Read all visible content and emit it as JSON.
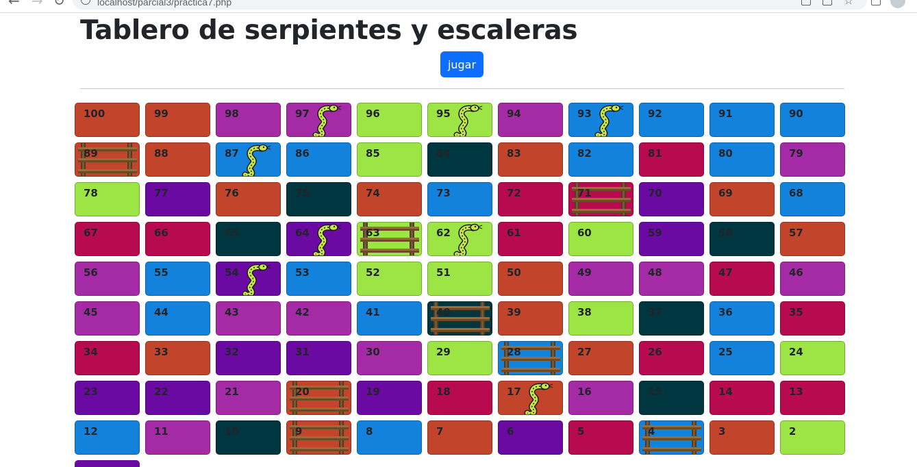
{
  "browser": {
    "url": "localhost/parcial3/practica7.php"
  },
  "page": {
    "title": "Tablero de serpientes y escaleras",
    "play_button": "jugar"
  },
  "colors": {
    "orange": "#c2452b",
    "purple": "#a52aa5",
    "green": "#9de445",
    "blue": "#1382dd",
    "darkteal": "#003640",
    "crimson": "#b80a4f",
    "violet": "#6b0aa3",
    "button": "#0d6efd"
  },
  "board": {
    "rows": [
      [
        {
          "n": "100",
          "c": "orange"
        },
        {
          "n": "99",
          "c": "orange"
        },
        {
          "n": "98",
          "c": "purple"
        },
        {
          "n": "97",
          "c": "purple",
          "img": "snake"
        },
        {
          "n": "96",
          "c": "green"
        },
        {
          "n": "95",
          "c": "green",
          "img": "snake"
        },
        {
          "n": "94",
          "c": "purple"
        },
        {
          "n": "93",
          "c": "blue",
          "img": "snake"
        },
        {
          "n": "92",
          "c": "blue"
        },
        {
          "n": "91",
          "c": "blue"
        },
        {
          "n": "90",
          "c": "blue"
        }
      ],
      [
        {
          "n": "89",
          "c": "orange",
          "img": "ladder"
        },
        {
          "n": "88",
          "c": "orange"
        },
        {
          "n": "87",
          "c": "blue",
          "img": "snake"
        },
        {
          "n": "86",
          "c": "blue"
        },
        {
          "n": "85",
          "c": "green"
        },
        {
          "n": "84",
          "c": "darkteal"
        },
        {
          "n": "83",
          "c": "orange"
        },
        {
          "n": "82",
          "c": "blue"
        },
        {
          "n": "81",
          "c": "crimson"
        },
        {
          "n": "80",
          "c": "blue"
        },
        {
          "n": "79",
          "c": "purple"
        }
      ],
      [
        {
          "n": "78",
          "c": "green"
        },
        {
          "n": "77",
          "c": "violet"
        },
        {
          "n": "76",
          "c": "orange"
        },
        {
          "n": "75",
          "c": "darkteal"
        },
        {
          "n": "74",
          "c": "orange"
        },
        {
          "n": "73",
          "c": "blue"
        },
        {
          "n": "72",
          "c": "crimson"
        },
        {
          "n": "71",
          "c": "crimson",
          "img": "ladder"
        },
        {
          "n": "70",
          "c": "violet"
        },
        {
          "n": "69",
          "c": "orange"
        },
        {
          "n": "68",
          "c": "blue"
        }
      ],
      [
        {
          "n": "67",
          "c": "crimson"
        },
        {
          "n": "66",
          "c": "crimson"
        },
        {
          "n": "65",
          "c": "darkteal"
        },
        {
          "n": "64",
          "c": "violet",
          "img": "snake"
        },
        {
          "n": "63",
          "c": "green",
          "img": "ladder"
        },
        {
          "n": "62",
          "c": "green",
          "img": "snake"
        },
        {
          "n": "61",
          "c": "crimson"
        },
        {
          "n": "60",
          "c": "green"
        },
        {
          "n": "59",
          "c": "violet"
        },
        {
          "n": "58",
          "c": "darkteal"
        },
        {
          "n": "57",
          "c": "orange"
        }
      ],
      [
        {
          "n": "56",
          "c": "purple"
        },
        {
          "n": "55",
          "c": "blue"
        },
        {
          "n": "54",
          "c": "violet",
          "img": "snake"
        },
        {
          "n": "53",
          "c": "blue"
        },
        {
          "n": "52",
          "c": "green"
        },
        {
          "n": "51",
          "c": "green"
        },
        {
          "n": "50",
          "c": "orange"
        },
        {
          "n": "49",
          "c": "purple"
        },
        {
          "n": "48",
          "c": "purple"
        },
        {
          "n": "47",
          "c": "crimson"
        },
        {
          "n": "46",
          "c": "purple"
        }
      ],
      [
        {
          "n": "45",
          "c": "purple"
        },
        {
          "n": "44",
          "c": "blue"
        },
        {
          "n": "43",
          "c": "purple"
        },
        {
          "n": "42",
          "c": "purple"
        },
        {
          "n": "41",
          "c": "blue"
        },
        {
          "n": "40",
          "c": "darkteal",
          "img": "ladder"
        },
        {
          "n": "39",
          "c": "orange"
        },
        {
          "n": "38",
          "c": "green"
        },
        {
          "n": "37",
          "c": "darkteal"
        },
        {
          "n": "36",
          "c": "blue"
        },
        {
          "n": "35",
          "c": "crimson"
        }
      ],
      [
        {
          "n": "34",
          "c": "crimson"
        },
        {
          "n": "33",
          "c": "orange"
        },
        {
          "n": "32",
          "c": "violet"
        },
        {
          "n": "31",
          "c": "violet"
        },
        {
          "n": "30",
          "c": "purple"
        },
        {
          "n": "29",
          "c": "green"
        },
        {
          "n": "28",
          "c": "blue",
          "img": "ladder"
        },
        {
          "n": "27",
          "c": "orange"
        },
        {
          "n": "26",
          "c": "crimson"
        },
        {
          "n": "25",
          "c": "blue"
        },
        {
          "n": "24",
          "c": "green"
        }
      ],
      [
        {
          "n": "23",
          "c": "violet"
        },
        {
          "n": "22",
          "c": "violet"
        },
        {
          "n": "21",
          "c": "purple"
        },
        {
          "n": "20",
          "c": "orange",
          "img": "ladder"
        },
        {
          "n": "19",
          "c": "violet"
        },
        {
          "n": "18",
          "c": "crimson"
        },
        {
          "n": "17",
          "c": "orange",
          "img": "snake"
        },
        {
          "n": "16",
          "c": "purple"
        },
        {
          "n": "15",
          "c": "darkteal"
        },
        {
          "n": "14",
          "c": "crimson"
        },
        {
          "n": "13",
          "c": "crimson"
        }
      ],
      [
        {
          "n": "12",
          "c": "blue"
        },
        {
          "n": "11",
          "c": "purple"
        },
        {
          "n": "10",
          "c": "darkteal"
        },
        {
          "n": "9",
          "c": "orange",
          "img": "ladder"
        },
        {
          "n": "8",
          "c": "blue"
        },
        {
          "n": "7",
          "c": "orange"
        },
        {
          "n": "6",
          "c": "violet"
        },
        {
          "n": "5",
          "c": "crimson"
        },
        {
          "n": "4",
          "c": "blue",
          "img": "ladder"
        },
        {
          "n": "3",
          "c": "orange"
        },
        {
          "n": "2",
          "c": "green"
        }
      ]
    ]
  }
}
